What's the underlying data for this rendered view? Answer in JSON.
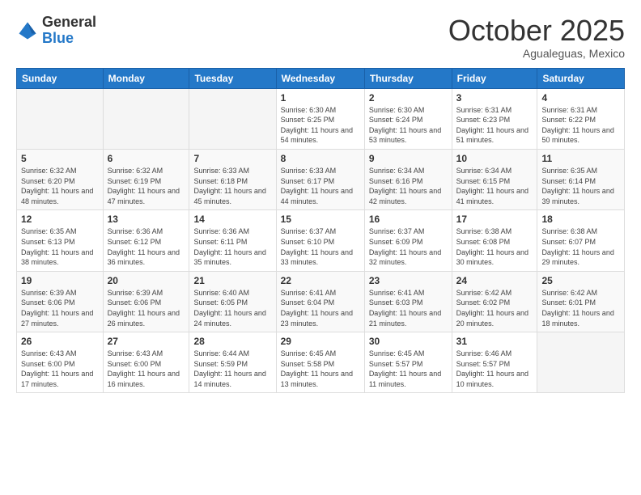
{
  "logo": {
    "general": "General",
    "blue": "Blue"
  },
  "header": {
    "month": "October 2025",
    "location": "Agualeguas, Mexico"
  },
  "weekdays": [
    "Sunday",
    "Monday",
    "Tuesday",
    "Wednesday",
    "Thursday",
    "Friday",
    "Saturday"
  ],
  "weeks": [
    [
      {
        "day": "",
        "info": ""
      },
      {
        "day": "",
        "info": ""
      },
      {
        "day": "",
        "info": ""
      },
      {
        "day": "1",
        "info": "Sunrise: 6:30 AM\nSunset: 6:25 PM\nDaylight: 11 hours\nand 54 minutes."
      },
      {
        "day": "2",
        "info": "Sunrise: 6:30 AM\nSunset: 6:24 PM\nDaylight: 11 hours\nand 53 minutes."
      },
      {
        "day": "3",
        "info": "Sunrise: 6:31 AM\nSunset: 6:23 PM\nDaylight: 11 hours\nand 51 minutes."
      },
      {
        "day": "4",
        "info": "Sunrise: 6:31 AM\nSunset: 6:22 PM\nDaylight: 11 hours\nand 50 minutes."
      }
    ],
    [
      {
        "day": "5",
        "info": "Sunrise: 6:32 AM\nSunset: 6:20 PM\nDaylight: 11 hours\nand 48 minutes."
      },
      {
        "day": "6",
        "info": "Sunrise: 6:32 AM\nSunset: 6:19 PM\nDaylight: 11 hours\nand 47 minutes."
      },
      {
        "day": "7",
        "info": "Sunrise: 6:33 AM\nSunset: 6:18 PM\nDaylight: 11 hours\nand 45 minutes."
      },
      {
        "day": "8",
        "info": "Sunrise: 6:33 AM\nSunset: 6:17 PM\nDaylight: 11 hours\nand 44 minutes."
      },
      {
        "day": "9",
        "info": "Sunrise: 6:34 AM\nSunset: 6:16 PM\nDaylight: 11 hours\nand 42 minutes."
      },
      {
        "day": "10",
        "info": "Sunrise: 6:34 AM\nSunset: 6:15 PM\nDaylight: 11 hours\nand 41 minutes."
      },
      {
        "day": "11",
        "info": "Sunrise: 6:35 AM\nSunset: 6:14 PM\nDaylight: 11 hours\nand 39 minutes."
      }
    ],
    [
      {
        "day": "12",
        "info": "Sunrise: 6:35 AM\nSunset: 6:13 PM\nDaylight: 11 hours\nand 38 minutes."
      },
      {
        "day": "13",
        "info": "Sunrise: 6:36 AM\nSunset: 6:12 PM\nDaylight: 11 hours\nand 36 minutes."
      },
      {
        "day": "14",
        "info": "Sunrise: 6:36 AM\nSunset: 6:11 PM\nDaylight: 11 hours\nand 35 minutes."
      },
      {
        "day": "15",
        "info": "Sunrise: 6:37 AM\nSunset: 6:10 PM\nDaylight: 11 hours\nand 33 minutes."
      },
      {
        "day": "16",
        "info": "Sunrise: 6:37 AM\nSunset: 6:09 PM\nDaylight: 11 hours\nand 32 minutes."
      },
      {
        "day": "17",
        "info": "Sunrise: 6:38 AM\nSunset: 6:08 PM\nDaylight: 11 hours\nand 30 minutes."
      },
      {
        "day": "18",
        "info": "Sunrise: 6:38 AM\nSunset: 6:07 PM\nDaylight: 11 hours\nand 29 minutes."
      }
    ],
    [
      {
        "day": "19",
        "info": "Sunrise: 6:39 AM\nSunset: 6:06 PM\nDaylight: 11 hours\nand 27 minutes."
      },
      {
        "day": "20",
        "info": "Sunrise: 6:39 AM\nSunset: 6:06 PM\nDaylight: 11 hours\nand 26 minutes."
      },
      {
        "day": "21",
        "info": "Sunrise: 6:40 AM\nSunset: 6:05 PM\nDaylight: 11 hours\nand 24 minutes."
      },
      {
        "day": "22",
        "info": "Sunrise: 6:41 AM\nSunset: 6:04 PM\nDaylight: 11 hours\nand 23 minutes."
      },
      {
        "day": "23",
        "info": "Sunrise: 6:41 AM\nSunset: 6:03 PM\nDaylight: 11 hours\nand 21 minutes."
      },
      {
        "day": "24",
        "info": "Sunrise: 6:42 AM\nSunset: 6:02 PM\nDaylight: 11 hours\nand 20 minutes."
      },
      {
        "day": "25",
        "info": "Sunrise: 6:42 AM\nSunset: 6:01 PM\nDaylight: 11 hours\nand 18 minutes."
      }
    ],
    [
      {
        "day": "26",
        "info": "Sunrise: 6:43 AM\nSunset: 6:00 PM\nDaylight: 11 hours\nand 17 minutes."
      },
      {
        "day": "27",
        "info": "Sunrise: 6:43 AM\nSunset: 6:00 PM\nDaylight: 11 hours\nand 16 minutes."
      },
      {
        "day": "28",
        "info": "Sunrise: 6:44 AM\nSunset: 5:59 PM\nDaylight: 11 hours\nand 14 minutes."
      },
      {
        "day": "29",
        "info": "Sunrise: 6:45 AM\nSunset: 5:58 PM\nDaylight: 11 hours\nand 13 minutes."
      },
      {
        "day": "30",
        "info": "Sunrise: 6:45 AM\nSunset: 5:57 PM\nDaylight: 11 hours\nand 11 minutes."
      },
      {
        "day": "31",
        "info": "Sunrise: 6:46 AM\nSunset: 5:57 PM\nDaylight: 11 hours\nand 10 minutes."
      },
      {
        "day": "",
        "info": ""
      }
    ]
  ]
}
